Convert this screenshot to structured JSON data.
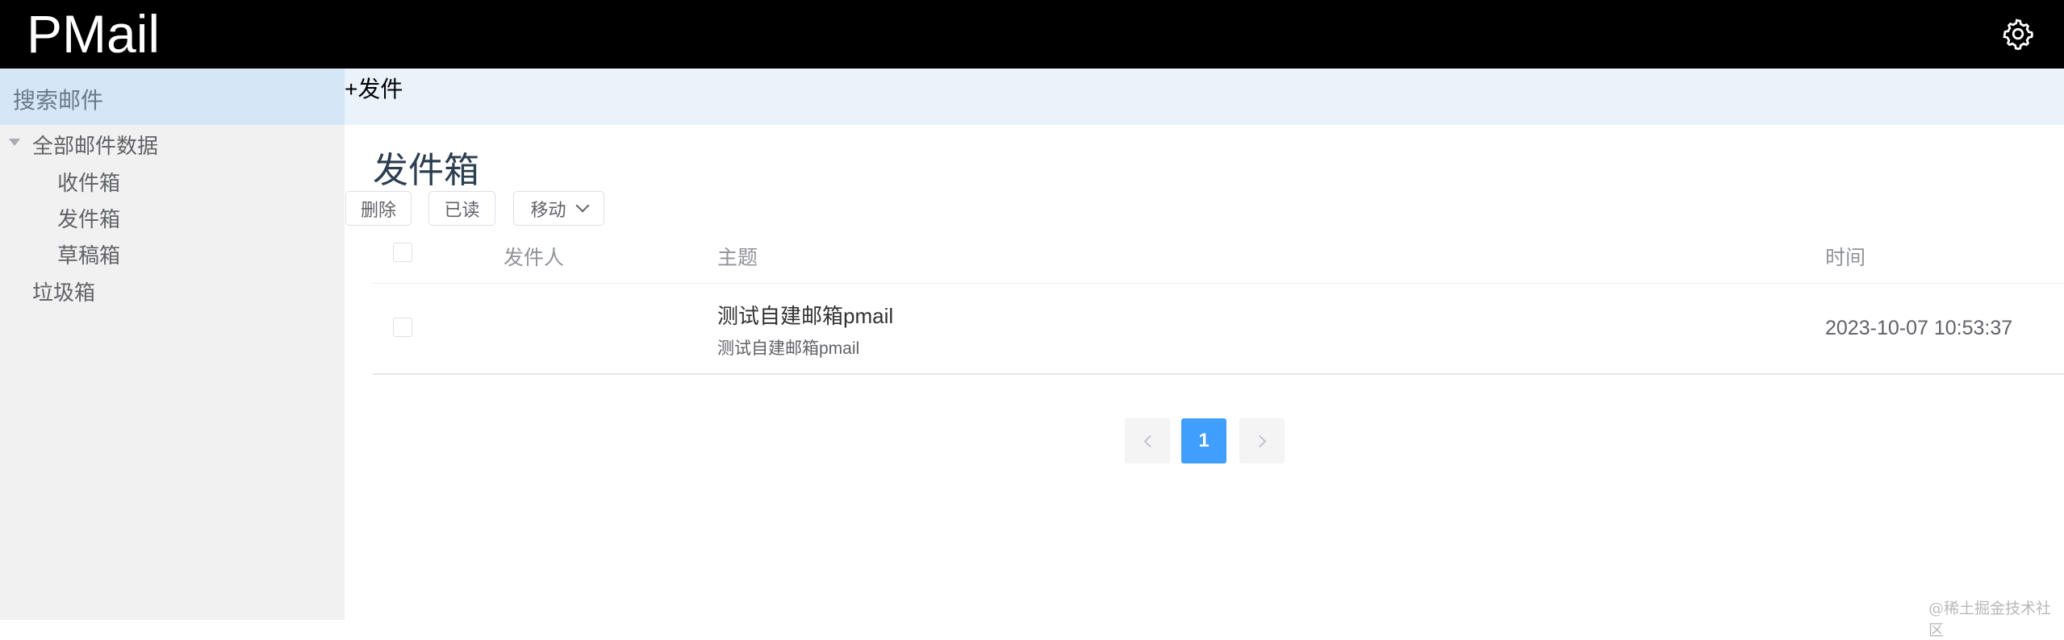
{
  "app": {
    "title": "PMail"
  },
  "header": {
    "settings_icon": "gear-icon"
  },
  "sidebar": {
    "search_label": "搜索邮件",
    "tree": {
      "root_label": "全部邮件数据",
      "children": [
        {
          "label": "收件箱"
        },
        {
          "label": "发件箱"
        },
        {
          "label": "草稿箱"
        }
      ],
      "trash_label": "垃圾箱"
    }
  },
  "toolbar": {
    "compose_label": "+发件"
  },
  "main": {
    "title": "发件箱",
    "actions": {
      "delete_label": "删除",
      "read_label": "已读",
      "move_label": "移动"
    },
    "table": {
      "columns": {
        "sender": "发件人",
        "subject": "主题",
        "time": "时间"
      },
      "rows": [
        {
          "sender": "",
          "subject": "测试自建邮箱pmail",
          "preview": "测试自建邮箱pmail",
          "time": "2023-10-07 10:53:37"
        }
      ]
    },
    "pagination": {
      "current_page": "1"
    }
  },
  "watermark": "@稀土掘金技术社区",
  "colors": {
    "accent": "#409eff",
    "topbar": "#000000",
    "search_bg": "#d5e6f7",
    "compose_bg": "#eaf2fa"
  }
}
